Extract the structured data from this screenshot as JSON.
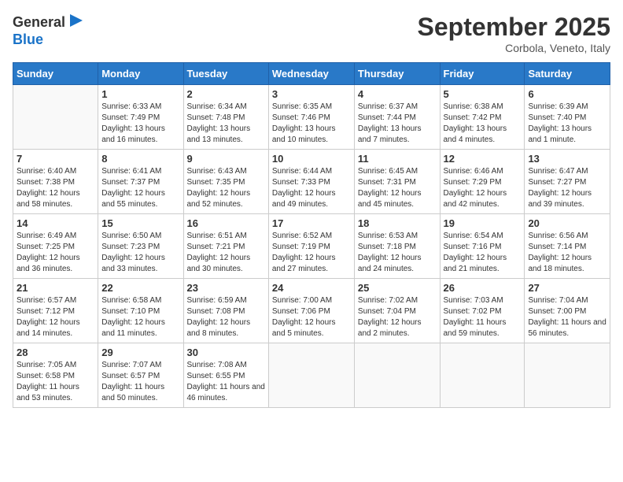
{
  "header": {
    "logo_general": "General",
    "logo_blue": "Blue",
    "month_title": "September 2025",
    "subtitle": "Corbola, Veneto, Italy"
  },
  "weekdays": [
    "Sunday",
    "Monday",
    "Tuesday",
    "Wednesday",
    "Thursday",
    "Friday",
    "Saturday"
  ],
  "weeks": [
    [
      {
        "day": "",
        "sunrise": "",
        "sunset": "",
        "daylight": ""
      },
      {
        "day": "1",
        "sunrise": "Sunrise: 6:33 AM",
        "sunset": "Sunset: 7:49 PM",
        "daylight": "Daylight: 13 hours and 16 minutes."
      },
      {
        "day": "2",
        "sunrise": "Sunrise: 6:34 AM",
        "sunset": "Sunset: 7:48 PM",
        "daylight": "Daylight: 13 hours and 13 minutes."
      },
      {
        "day": "3",
        "sunrise": "Sunrise: 6:35 AM",
        "sunset": "Sunset: 7:46 PM",
        "daylight": "Daylight: 13 hours and 10 minutes."
      },
      {
        "day": "4",
        "sunrise": "Sunrise: 6:37 AM",
        "sunset": "Sunset: 7:44 PM",
        "daylight": "Daylight: 13 hours and 7 minutes."
      },
      {
        "day": "5",
        "sunrise": "Sunrise: 6:38 AM",
        "sunset": "Sunset: 7:42 PM",
        "daylight": "Daylight: 13 hours and 4 minutes."
      },
      {
        "day": "6",
        "sunrise": "Sunrise: 6:39 AM",
        "sunset": "Sunset: 7:40 PM",
        "daylight": "Daylight: 13 hours and 1 minute."
      }
    ],
    [
      {
        "day": "7",
        "sunrise": "Sunrise: 6:40 AM",
        "sunset": "Sunset: 7:38 PM",
        "daylight": "Daylight: 12 hours and 58 minutes."
      },
      {
        "day": "8",
        "sunrise": "Sunrise: 6:41 AM",
        "sunset": "Sunset: 7:37 PM",
        "daylight": "Daylight: 12 hours and 55 minutes."
      },
      {
        "day": "9",
        "sunrise": "Sunrise: 6:43 AM",
        "sunset": "Sunset: 7:35 PM",
        "daylight": "Daylight: 12 hours and 52 minutes."
      },
      {
        "day": "10",
        "sunrise": "Sunrise: 6:44 AM",
        "sunset": "Sunset: 7:33 PM",
        "daylight": "Daylight: 12 hours and 49 minutes."
      },
      {
        "day": "11",
        "sunrise": "Sunrise: 6:45 AM",
        "sunset": "Sunset: 7:31 PM",
        "daylight": "Daylight: 12 hours and 45 minutes."
      },
      {
        "day": "12",
        "sunrise": "Sunrise: 6:46 AM",
        "sunset": "Sunset: 7:29 PM",
        "daylight": "Daylight: 12 hours and 42 minutes."
      },
      {
        "day": "13",
        "sunrise": "Sunrise: 6:47 AM",
        "sunset": "Sunset: 7:27 PM",
        "daylight": "Daylight: 12 hours and 39 minutes."
      }
    ],
    [
      {
        "day": "14",
        "sunrise": "Sunrise: 6:49 AM",
        "sunset": "Sunset: 7:25 PM",
        "daylight": "Daylight: 12 hours and 36 minutes."
      },
      {
        "day": "15",
        "sunrise": "Sunrise: 6:50 AM",
        "sunset": "Sunset: 7:23 PM",
        "daylight": "Daylight: 12 hours and 33 minutes."
      },
      {
        "day": "16",
        "sunrise": "Sunrise: 6:51 AM",
        "sunset": "Sunset: 7:21 PM",
        "daylight": "Daylight: 12 hours and 30 minutes."
      },
      {
        "day": "17",
        "sunrise": "Sunrise: 6:52 AM",
        "sunset": "Sunset: 7:19 PM",
        "daylight": "Daylight: 12 hours and 27 minutes."
      },
      {
        "day": "18",
        "sunrise": "Sunrise: 6:53 AM",
        "sunset": "Sunset: 7:18 PM",
        "daylight": "Daylight: 12 hours and 24 minutes."
      },
      {
        "day": "19",
        "sunrise": "Sunrise: 6:54 AM",
        "sunset": "Sunset: 7:16 PM",
        "daylight": "Daylight: 12 hours and 21 minutes."
      },
      {
        "day": "20",
        "sunrise": "Sunrise: 6:56 AM",
        "sunset": "Sunset: 7:14 PM",
        "daylight": "Daylight: 12 hours and 18 minutes."
      }
    ],
    [
      {
        "day": "21",
        "sunrise": "Sunrise: 6:57 AM",
        "sunset": "Sunset: 7:12 PM",
        "daylight": "Daylight: 12 hours and 14 minutes."
      },
      {
        "day": "22",
        "sunrise": "Sunrise: 6:58 AM",
        "sunset": "Sunset: 7:10 PM",
        "daylight": "Daylight: 12 hours and 11 minutes."
      },
      {
        "day": "23",
        "sunrise": "Sunrise: 6:59 AM",
        "sunset": "Sunset: 7:08 PM",
        "daylight": "Daylight: 12 hours and 8 minutes."
      },
      {
        "day": "24",
        "sunrise": "Sunrise: 7:00 AM",
        "sunset": "Sunset: 7:06 PM",
        "daylight": "Daylight: 12 hours and 5 minutes."
      },
      {
        "day": "25",
        "sunrise": "Sunrise: 7:02 AM",
        "sunset": "Sunset: 7:04 PM",
        "daylight": "Daylight: 12 hours and 2 minutes."
      },
      {
        "day": "26",
        "sunrise": "Sunrise: 7:03 AM",
        "sunset": "Sunset: 7:02 PM",
        "daylight": "Daylight: 11 hours and 59 minutes."
      },
      {
        "day": "27",
        "sunrise": "Sunrise: 7:04 AM",
        "sunset": "Sunset: 7:00 PM",
        "daylight": "Daylight: 11 hours and 56 minutes."
      }
    ],
    [
      {
        "day": "28",
        "sunrise": "Sunrise: 7:05 AM",
        "sunset": "Sunset: 6:58 PM",
        "daylight": "Daylight: 11 hours and 53 minutes."
      },
      {
        "day": "29",
        "sunrise": "Sunrise: 7:07 AM",
        "sunset": "Sunset: 6:57 PM",
        "daylight": "Daylight: 11 hours and 50 minutes."
      },
      {
        "day": "30",
        "sunrise": "Sunrise: 7:08 AM",
        "sunset": "Sunset: 6:55 PM",
        "daylight": "Daylight: 11 hours and 46 minutes."
      },
      {
        "day": "",
        "sunrise": "",
        "sunset": "",
        "daylight": ""
      },
      {
        "day": "",
        "sunrise": "",
        "sunset": "",
        "daylight": ""
      },
      {
        "day": "",
        "sunrise": "",
        "sunset": "",
        "daylight": ""
      },
      {
        "day": "",
        "sunrise": "",
        "sunset": "",
        "daylight": ""
      }
    ]
  ]
}
